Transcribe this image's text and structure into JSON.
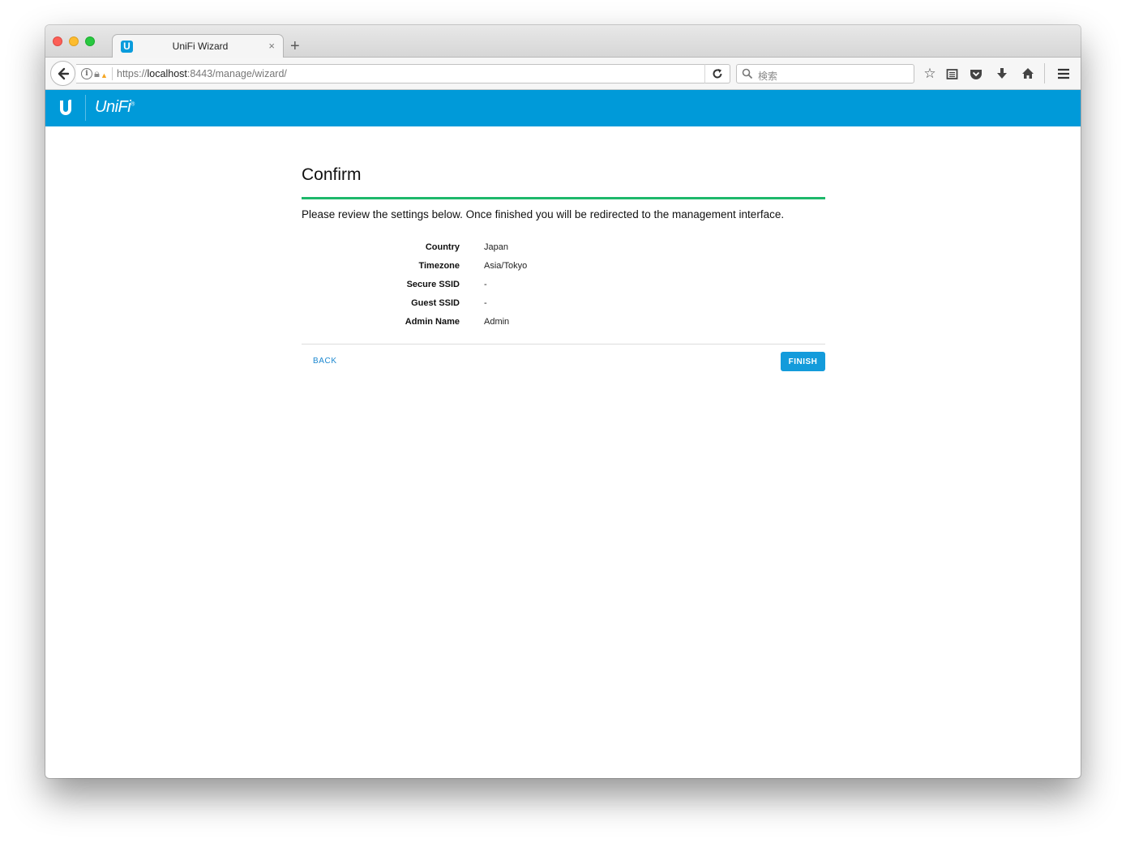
{
  "browser": {
    "tab_title": "UniFi Wizard",
    "tab_favicon": "U",
    "url_scheme": "https://",
    "url_host": "localhost",
    "url_rest": ":8443/manage/wizard/",
    "search_placeholder": "検索",
    "new_tab_label": "+",
    "close_tab_label": "×"
  },
  "header": {
    "brand": "UniFi",
    "brand_mark": "®"
  },
  "wizard": {
    "title": "Confirm",
    "progress_percent": 100,
    "intro": "Please review the settings below. Once finished you will be redirected to the management interface.",
    "settings": [
      {
        "label": "Country",
        "value": "Japan"
      },
      {
        "label": "Timezone",
        "value": "Asia/Tokyo"
      },
      {
        "label": "Secure SSID",
        "value": "-"
      },
      {
        "label": "Guest SSID",
        "value": "-"
      },
      {
        "label": "Admin Name",
        "value": "Admin"
      }
    ],
    "back_label": "BACK",
    "finish_label": "FINISH"
  },
  "colors": {
    "header_blue": "#009ad9",
    "progress_green": "#1eb86b",
    "button_blue": "#139bdb",
    "link_blue": "#1c88d0"
  },
  "icons": {
    "toolbar": [
      "bookmark-star-icon",
      "reading-list-icon",
      "pocket-icon",
      "download-icon",
      "home-icon",
      "menu-icon"
    ]
  }
}
